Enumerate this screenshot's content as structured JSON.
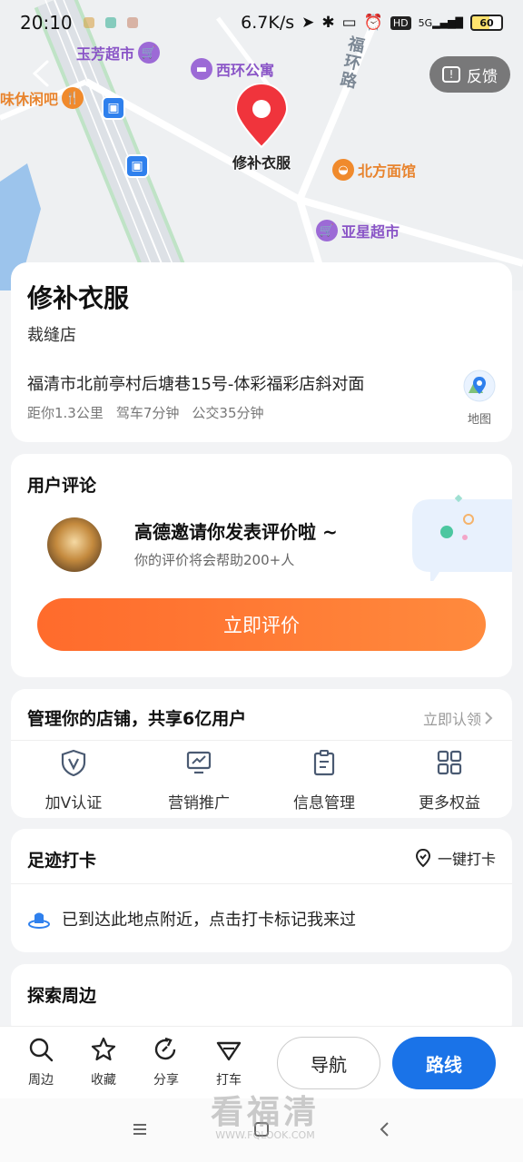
{
  "status_bar": {
    "time": "20:10",
    "speed": "6.7K/s",
    "network": "5G",
    "hd": "HD",
    "battery": "60"
  },
  "map": {
    "pois": [
      {
        "name": "玉芳超市",
        "color": "purple"
      },
      {
        "name": "西环公寓",
        "color": "purple"
      },
      {
        "name": "味休闲吧",
        "color": "orange"
      },
      {
        "name": "北方面馆",
        "color": "orange"
      },
      {
        "name": "亚星超市",
        "color": "purple"
      }
    ],
    "road_label": "福环路",
    "selected_label": "修补衣服",
    "feedback_label": "反馈"
  },
  "place": {
    "title": "修补衣服",
    "category": "裁缝店",
    "address": "福清市北前亭村后塘巷15号-体彩福彩店斜对面",
    "distance": "距你1.3公里",
    "drive": "驾车7分钟",
    "bus": "公交35分钟",
    "map_label": "地图"
  },
  "review": {
    "section_title": "用户评论",
    "invite_title": "高德邀请你发表评价啦 ~",
    "invite_sub": "你的评价将会帮助200+人",
    "button": "立即评价"
  },
  "store": {
    "title": "管理你的店铺，共享6亿用户",
    "claim": "立即认领",
    "items": [
      {
        "label": "加V认证",
        "icon": "verified-v-icon"
      },
      {
        "label": "营销推广",
        "icon": "chart-monitor-icon"
      },
      {
        "label": "信息管理",
        "icon": "clipboard-icon"
      },
      {
        "label": "更多权益",
        "icon": "grid-icon"
      }
    ]
  },
  "checkin": {
    "title": "足迹打卡",
    "button": "一键打卡",
    "message": "已到达此地点附近，点击打卡标记我来过"
  },
  "explore": {
    "title": "探索周边"
  },
  "bottom_bar": {
    "nearby": "周边",
    "favorite": "收藏",
    "share": "分享",
    "taxi": "打车",
    "navigate": "导航",
    "route": "路线"
  },
  "watermark": {
    "text": "看福清",
    "url": "WWW.FQLOOK.COM"
  },
  "colors": {
    "accent_blue": "#1a73e8",
    "accent_orange": "#ff6b2c",
    "pin_red": "#f0343c",
    "poi_purple": "#9c6ad6"
  }
}
